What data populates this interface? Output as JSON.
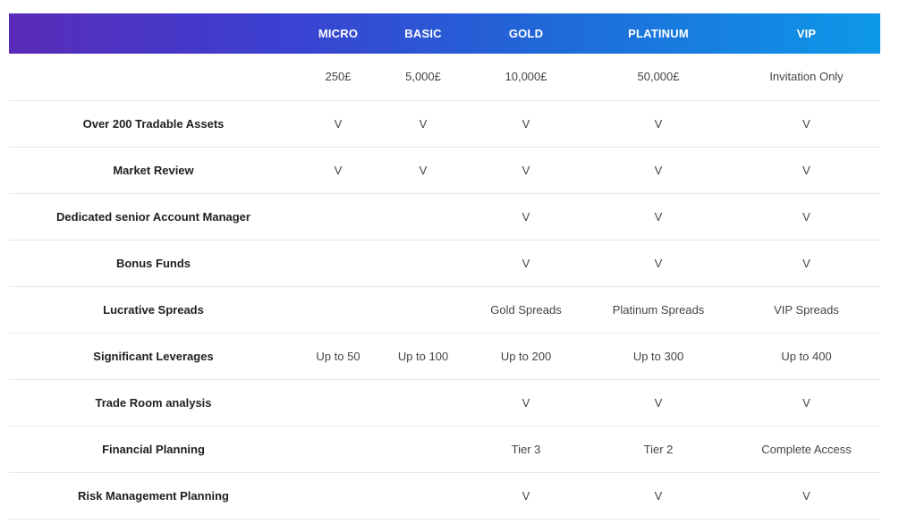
{
  "header": {
    "plans": [
      "MICRO",
      "BASIC",
      "GOLD",
      "PLATINUM",
      "VIP"
    ]
  },
  "prices": [
    "250£",
    "5,000£",
    "10,000£",
    "50,000£",
    "Invitation Only"
  ],
  "rows": [
    {
      "feature": "Over 200 Tradable Assets",
      "values": [
        "V",
        "V",
        "V",
        "V",
        "V"
      ]
    },
    {
      "feature": "Market Review",
      "values": [
        "V",
        "V",
        "V",
        "V",
        "V"
      ]
    },
    {
      "feature": "Dedicated senior Account Manager",
      "values": [
        "",
        "",
        "V",
        "V",
        "V"
      ]
    },
    {
      "feature": "Bonus Funds",
      "values": [
        "",
        "",
        "V",
        "V",
        "V"
      ]
    },
    {
      "feature": "Lucrative Spreads",
      "values": [
        "",
        "",
        "Gold Spreads",
        "Platinum Spreads",
        "VIP Spreads"
      ]
    },
    {
      "feature": "Significant Leverages",
      "values": [
        "Up to 50",
        "Up to 100",
        "Up to 200",
        "Up to 300",
        "Up to 400"
      ]
    },
    {
      "feature": "Trade Room analysis",
      "values": [
        "",
        "",
        "V",
        "V",
        "V"
      ]
    },
    {
      "feature": "Financial Planning",
      "values": [
        "",
        "",
        "Tier 3",
        "Tier 2",
        "Complete Access"
      ]
    },
    {
      "feature": "Risk Management Planning",
      "values": [
        "",
        "",
        "V",
        "V",
        "V"
      ]
    }
  ],
  "colors": {
    "header_gradient_start": "#5a2bb8",
    "header_gradient_end": "#0d98e8",
    "header_text": "#ffffff",
    "row_divider": "#e8e8e8"
  }
}
